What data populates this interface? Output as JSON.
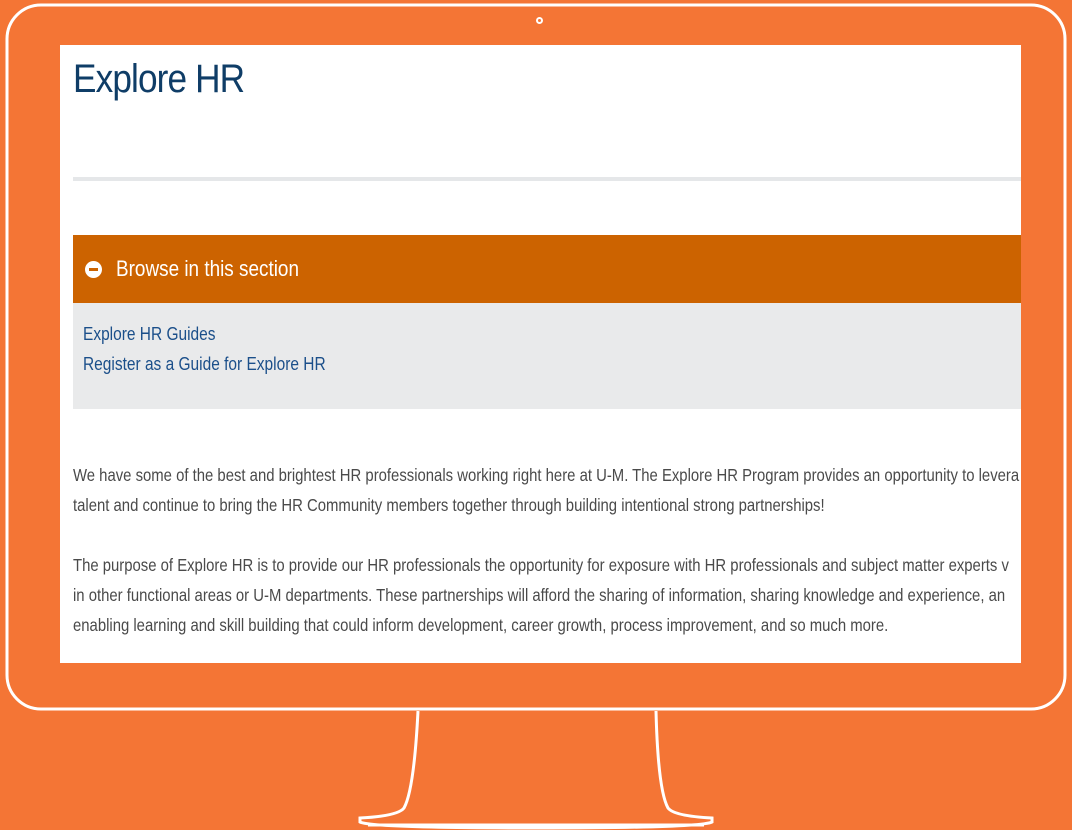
{
  "page": {
    "title": "Explore HR"
  },
  "browse": {
    "header_label": "Browse in this section",
    "links": [
      {
        "label": "Explore HR Guides"
      },
      {
        "label": "Register as a Guide for Explore HR"
      }
    ]
  },
  "content": {
    "paragraph1": [
      "We have some of the best and brightest HR professionals working right here at U-M. The Explore HR Program provides an opportunity to levera",
      "talent and continue to bring the HR Community members together through building intentional strong partnerships!"
    ],
    "paragraph2": [
      "The purpose of Explore HR is to provide our HR professionals the opportunity for exposure with HR professionals and subject matter experts v",
      "in other functional areas or U-M departments. These partnerships will afford the sharing of information, sharing knowledge and experience, an",
      "enabling learning and skill building that could inform development, career growth, process improvement, and so much more."
    ]
  },
  "colors": {
    "background": "#f47535",
    "title": "#0f3d67",
    "browse_header": "#cc6300",
    "browse_panel": "#e9eaeb",
    "link": "#1b4f8a",
    "body_text": "#4a4a4a"
  },
  "icons": {
    "browse_toggle": "minus-circle-icon",
    "camera": "camera-icon"
  }
}
